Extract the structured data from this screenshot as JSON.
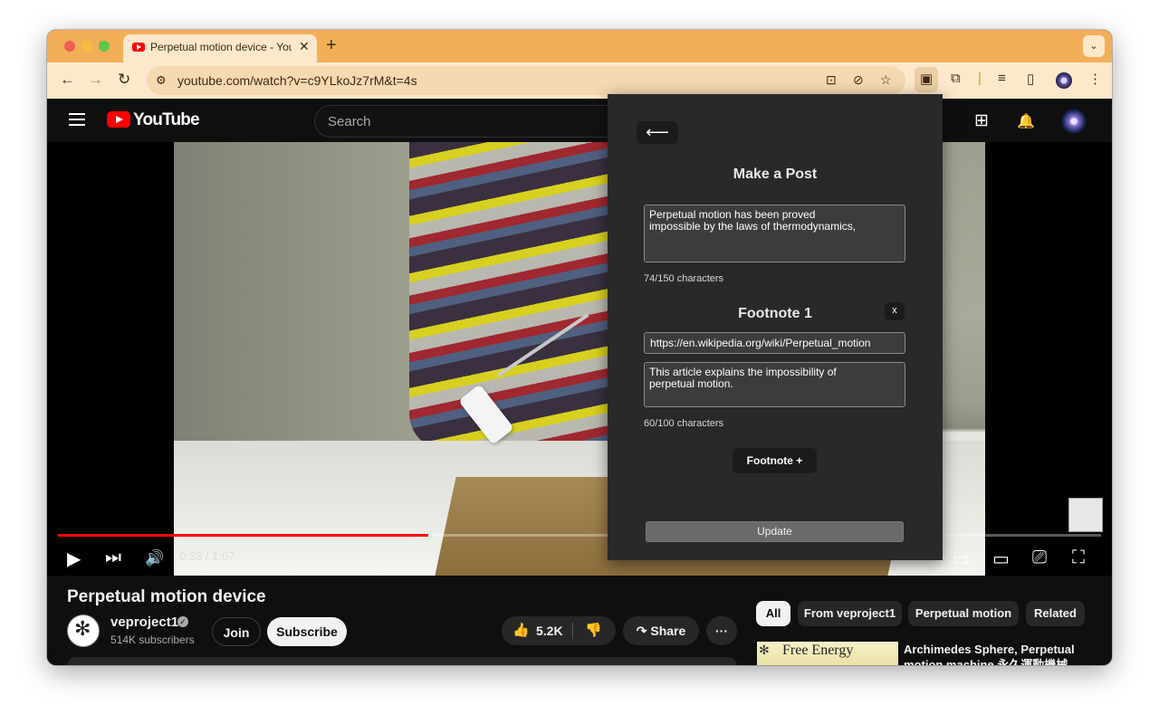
{
  "browser": {
    "tab_title": "Perpetual motion device - YouTube",
    "tab_close": "✕",
    "new_tab": "+",
    "tab_menu": "⌄",
    "url": "youtube.com/watch?v=c9YLkoJz7rM&t=4s",
    "icons": {
      "back": "←",
      "forward": "→",
      "reload": "↻",
      "site_info": "⚙",
      "install": "⊡",
      "eye_off": "⊘",
      "star": "☆",
      "extension_active": "▣",
      "puzzle": "⧉",
      "media": "≡",
      "sidepanel": "▯",
      "menu": "⋮"
    }
  },
  "youtube": {
    "wordmark": "YouTube",
    "search_placeholder": "Search",
    "header_icons": {
      "create": "⊞",
      "notifications": "🔔"
    },
    "player": {
      "time": "0:23 / 1:07",
      "progress": 0.355,
      "controls": {
        "play": "▶",
        "next": "⏭",
        "volume": "🔊",
        "miniplayer": "▭",
        "theater": "▭",
        "cast": "⎚",
        "fullscreen": "⛶"
      }
    },
    "video_title": "Perpetual motion device",
    "channel": {
      "name": "veproject1",
      "verified": "✓",
      "subscribers": "514K subscribers"
    },
    "buttons": {
      "join": "Join",
      "subscribe": "Subscribe",
      "like_count": "5.2K",
      "like_icon": "👍",
      "dislike_icon": "👎",
      "share": "↷ Share",
      "more": "···"
    },
    "chips": [
      "All",
      "From veproject1",
      "Perpetual motion",
      "Related"
    ],
    "recommendation": {
      "thumb_text": "Free Energy",
      "thumb_logo": "✻",
      "title": "Archimedes Sphere, Perpetual motion machine 永久運動機械"
    }
  },
  "popup": {
    "back_label": "⟵",
    "heading": "Make a Post",
    "post_text": "Perpetual motion has been proved\nimpossible by the laws of thermodynamics,",
    "post_counter": "74/150 characters",
    "footnote_heading": "Footnote 1",
    "footnote_close": "x",
    "footnote_url": "https://en.wikipedia.org/wiki/Perpetual_motion",
    "footnote_text": "This article explains the impossibility of\nperpetual motion.",
    "footnote_counter": "60/100 characters",
    "add_footnote": "Footnote +",
    "update": "Update"
  }
}
